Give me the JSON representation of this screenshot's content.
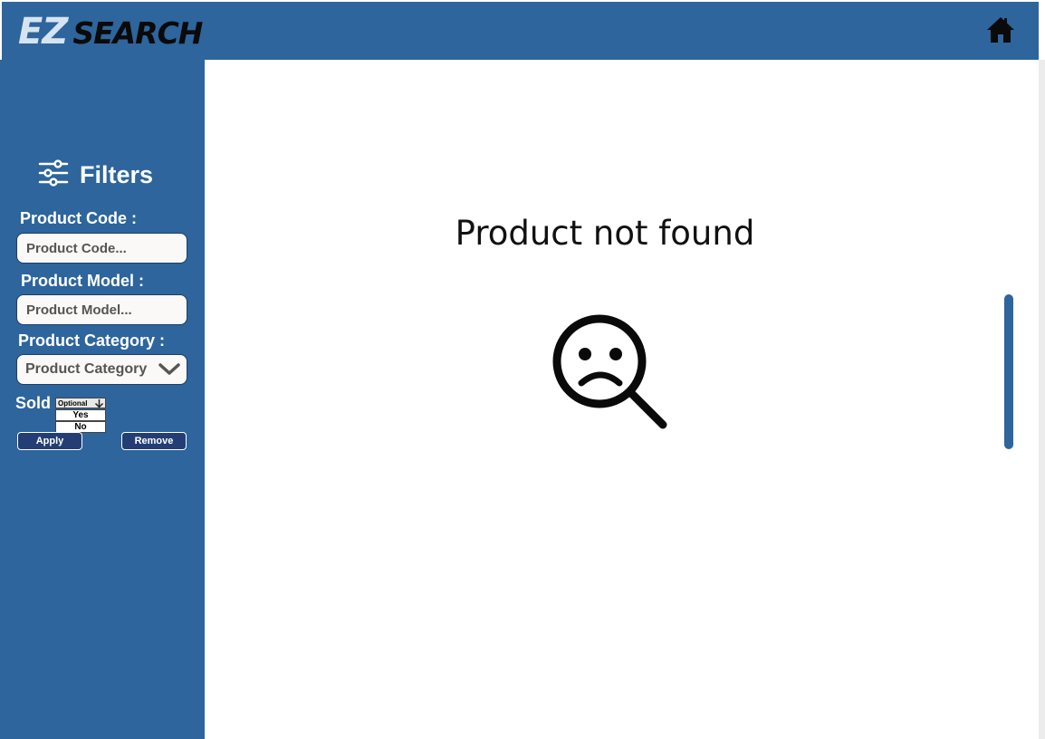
{
  "header": {
    "logo_ez": "EZ",
    "logo_search": "SEARCH",
    "home_icon": "home-icon",
    "color": "#2d659c"
  },
  "sidebar": {
    "filters_title": "Filters",
    "filters_icon": "sliders-icon",
    "product_code": {
      "label": "Product Code :",
      "placeholder": "Product Code..."
    },
    "product_model": {
      "label": "Product Model :",
      "placeholder": "Product Model..."
    },
    "product_category": {
      "label": "Product Category :",
      "value": "Product Category",
      "icon": "chevron-down-icon"
    },
    "sold": {
      "label": "Sold",
      "selected": "Optional",
      "options": [
        "Yes",
        "No"
      ]
    },
    "apply_label": "Apply",
    "remove_label": "Remove"
  },
  "main": {
    "message": "Product not found",
    "illustration_icon": "sad-magnifier-icon"
  }
}
